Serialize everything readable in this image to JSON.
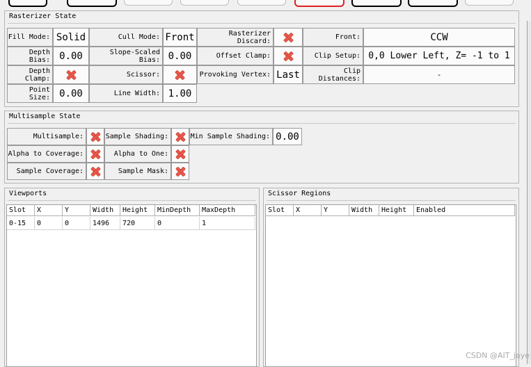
{
  "rasterizer": {
    "title": "Rasterizer State",
    "fill_mode": {
      "label": "Fill Mode:",
      "value": "Solid"
    },
    "cull_mode": {
      "label": "Cull Mode:",
      "value": "Front"
    },
    "rasterizer_discard": {
      "label": "Rasterizer Discard:",
      "value": "false"
    },
    "front": {
      "label": "Front:",
      "value": "CCW"
    },
    "depth_bias": {
      "label": "Depth Bias:",
      "value": "0.00"
    },
    "slope_scaled_bias": {
      "label": "Slope-Scaled Bias:",
      "value": "0.00"
    },
    "offset_clamp": {
      "label": "Offset Clamp:",
      "value": "false"
    },
    "clip_setup": {
      "label": "Clip Setup:",
      "value": "0,0 Lower Left, Z= -1 to 1"
    },
    "depth_clamp": {
      "label": "Depth Clamp:",
      "value": "false"
    },
    "scissor": {
      "label": "Scissor:",
      "value": "false"
    },
    "provoking_vertex": {
      "label": "Provoking Vertex:",
      "value": "Last"
    },
    "clip_distances": {
      "label": "Clip Distances:",
      "value": "-"
    },
    "point_size": {
      "label": "Point Size:",
      "value": "0.00"
    },
    "line_width": {
      "label": "Line Width:",
      "value": "1.00"
    }
  },
  "multisample": {
    "title": "Multisample State",
    "multisample": {
      "label": "Multisample:",
      "value": "false"
    },
    "sample_shading": {
      "label": "Sample Shading:",
      "value": "false"
    },
    "min_sample_shading": {
      "label": "Min Sample Shading:",
      "value": "0.00"
    },
    "alpha_to_coverage": {
      "label": "Alpha to Coverage:",
      "value": "false"
    },
    "alpha_to_one": {
      "label": "Alpha to One:",
      "value": "false"
    },
    "sample_coverage": {
      "label": "Sample Coverage:",
      "value": "false"
    },
    "sample_mask": {
      "label": "Sample Mask:",
      "value": "false"
    }
  },
  "viewports": {
    "title": "Viewports",
    "columns": [
      "Slot",
      "X",
      "Y",
      "Width",
      "Height",
      "MinDepth",
      "MaxDepth"
    ],
    "rows": [
      [
        "0-15",
        "0",
        "0",
        "1496",
        "720",
        "0",
        "1"
      ]
    ]
  },
  "scissors": {
    "title": "Scissor Regions",
    "columns": [
      "Slot",
      "X",
      "Y",
      "Width",
      "Height",
      "Enabled"
    ]
  },
  "watermark": "CSDN @AIT_jaye",
  "colors": {
    "cross": "#e8584a",
    "active_stage": "#e02020"
  }
}
